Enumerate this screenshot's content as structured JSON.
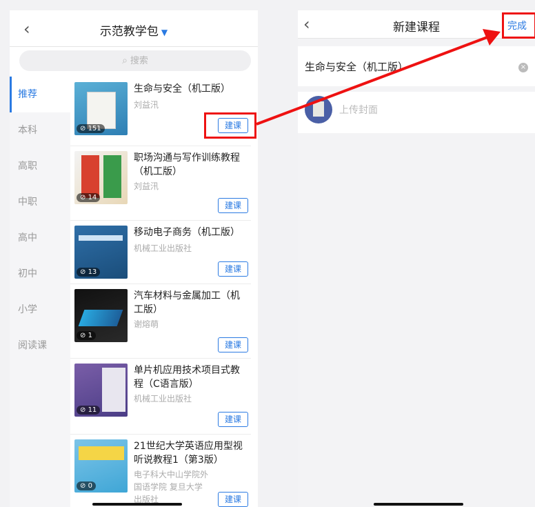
{
  "left": {
    "title": "示范教学包",
    "search_placeholder": "搜索",
    "categories": [
      "推荐",
      "本科",
      "高职",
      "中职",
      "高中",
      "初中",
      "小学",
      "阅读课"
    ],
    "active_category": "推荐",
    "build_label": "建课",
    "books": [
      {
        "title": "生命与安全（机工版）",
        "author": "刘益汛",
        "count": "151"
      },
      {
        "title": "职场沟通与写作训练教程（机工版）",
        "author": "刘益汛",
        "count": "14"
      },
      {
        "title": "移动电子商务（机工版）",
        "author": "机械工业出版社",
        "count": "13"
      },
      {
        "title": "汽车材料与金属加工（机工版）",
        "author": "谢熔萌",
        "count": "1"
      },
      {
        "title": "单片机应用技术项目式教程（C语言版）",
        "author": "机械工业出版社",
        "count": "11"
      },
      {
        "title": "21世纪大学英语应用型视听说教程1（第3版）",
        "author": "电子科大中山学院外国语学院 复旦大学出版社",
        "count": "0"
      }
    ]
  },
  "right": {
    "title": "新建课程",
    "done_label": "完成",
    "course_name": "生命与安全（机工版）",
    "upload_label": "上传封面"
  },
  "colors": {
    "accent": "#2a7ae2",
    "highlight": "#e11111"
  }
}
